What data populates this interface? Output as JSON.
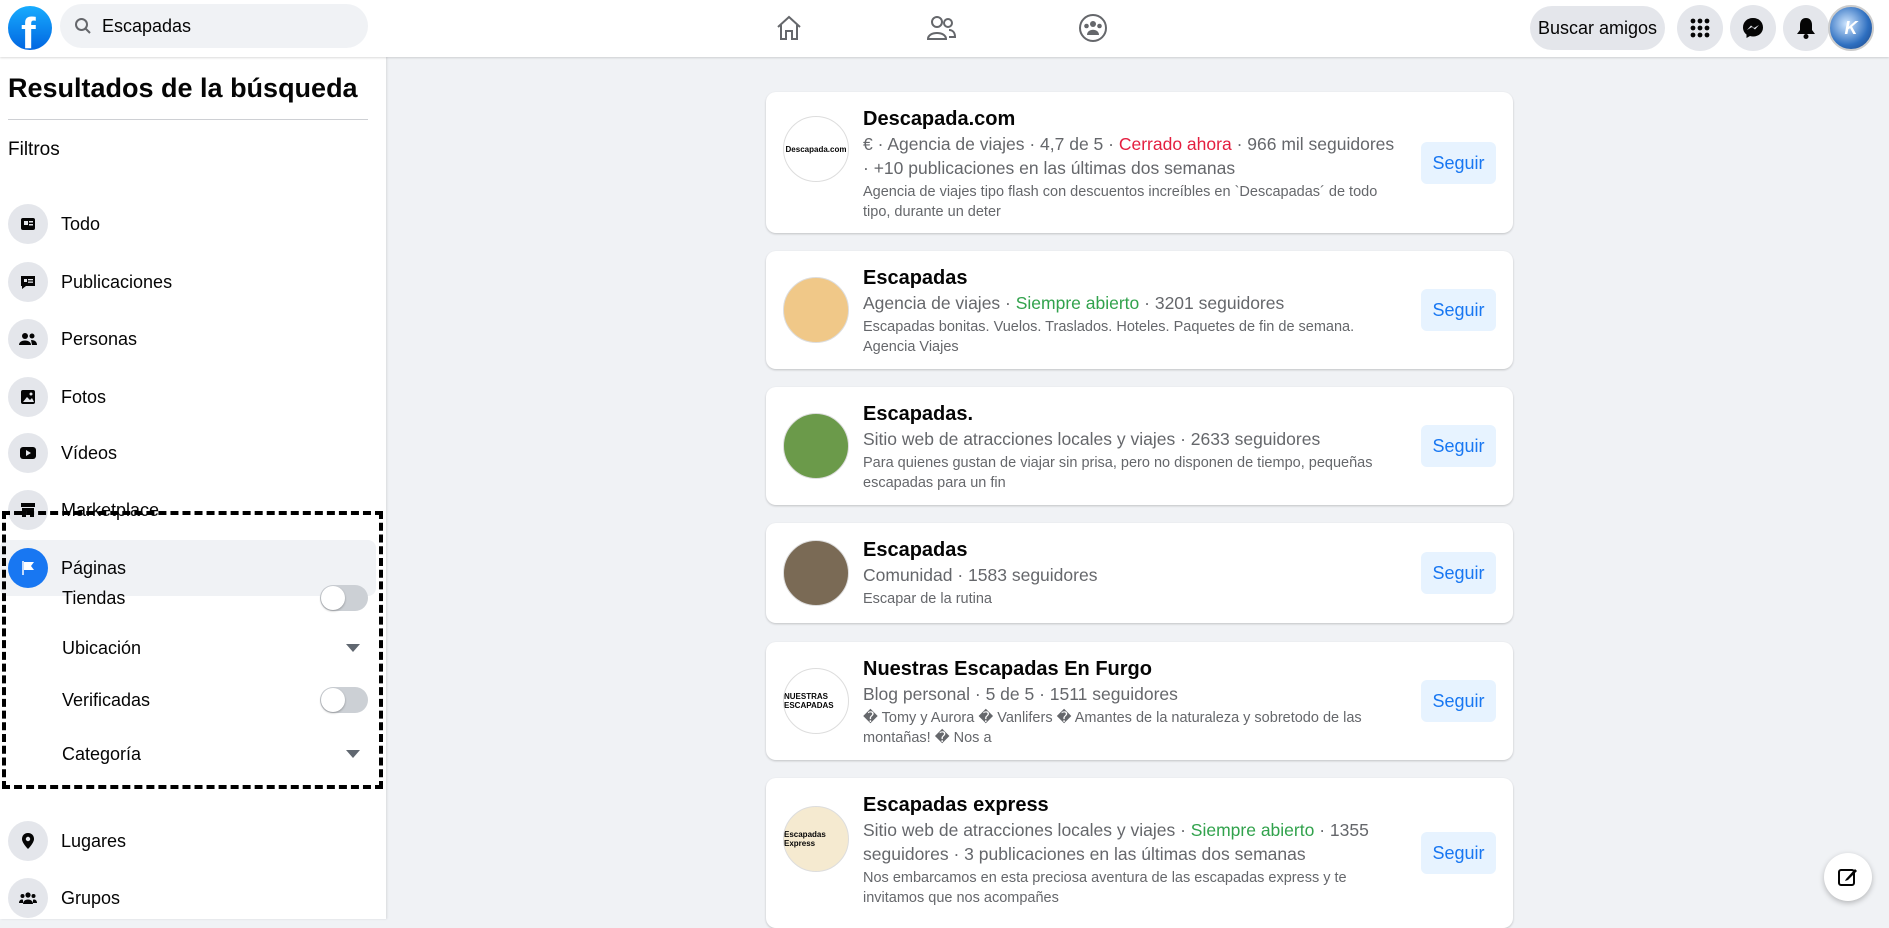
{
  "header": {
    "search_value": "Escapadas",
    "find_friends": "Buscar amigos",
    "avatar_text": "K"
  },
  "sidebar": {
    "title": "Resultados de la búsqueda",
    "filters_label": "Filtros",
    "items": [
      {
        "label": "Todo",
        "icon": "feed-icon"
      },
      {
        "label": "Publicaciones",
        "icon": "posts-icon"
      },
      {
        "label": "Personas",
        "icon": "people-icon"
      },
      {
        "label": "Fotos",
        "icon": "photos-icon"
      },
      {
        "label": "Vídeos",
        "icon": "video-icon"
      },
      {
        "label": "Marketplace",
        "icon": "store-icon"
      },
      {
        "label": "Páginas",
        "icon": "flag-icon",
        "active": true
      },
      {
        "label": "Lugares",
        "icon": "pin-icon"
      },
      {
        "label": "Grupos",
        "icon": "groups-icon"
      }
    ],
    "page_filters": [
      {
        "label": "Tiendas",
        "type": "toggle",
        "on": false
      },
      {
        "label": "Ubicación",
        "type": "dropdown"
      },
      {
        "label": "Verificadas",
        "type": "toggle",
        "on": false
      },
      {
        "label": "Categoría",
        "type": "dropdown"
      }
    ]
  },
  "results": [
    {
      "name": "Descapada.com",
      "meta_a": "€ · Agencia de viajes · 4,7 de 5 · ",
      "status": "Cerrado ahora",
      "status_color": "#e41e3f",
      "meta_b": " · 966 mil seguidores · +10 publicaciones en las últimas dos semanas",
      "desc": "Agencia de viajes tipo flash con descuentos increíbles en `Descapadas´ de todo tipo, durante un deter",
      "avatar_text": "Descapada.com",
      "button": "Seguir"
    },
    {
      "name": "Escapadas",
      "meta_a": "Agencia de viajes · ",
      "status": "Siempre abierto",
      "status_color": "#31a24c",
      "meta_b": " · 3201 seguidores",
      "desc": "Escapadas bonitas. Vuelos. Traslados. Hoteles. Paquetes de fin de semana. Agencia Viajes",
      "avatar_text": "",
      "button": "Seguir"
    },
    {
      "name": "Escapadas.",
      "meta_a": "Sitio web de atracciones locales y viajes · 2633 seguidores",
      "status": "",
      "meta_b": "",
      "desc": "Para quienes gustan de viajar sin prisa, pero no disponen de tiempo, pequeñas escapadas para un fin",
      "avatar_text": "",
      "button": "Seguir"
    },
    {
      "name": "Escapadas",
      "meta_a": "Comunidad · 1583 seguidores",
      "status": "",
      "meta_b": "",
      "desc": "Escapar de la rutina",
      "avatar_text": "",
      "button": "Seguir"
    },
    {
      "name": "Nuestras Escapadas En Furgo",
      "meta_a": "Blog personal · 5 de 5 · 1511 seguidores",
      "status": "",
      "meta_b": "",
      "desc": "� Tomy y Aurora � Vanlifers � Amantes de la naturaleza y sobretodo de las montañas! � Nos a",
      "avatar_text": "NUESTRAS ESCAPADAS",
      "button": "Seguir"
    },
    {
      "name": "Escapadas express",
      "meta_a": "Sitio web de atracciones locales y viajes · ",
      "status": "Siempre abierto",
      "status_color": "#31a24c",
      "meta_b": " · 1355 seguidores · 3 publicaciones en las últimas dos semanas",
      "desc": "Nos embarcamos en esta preciosa aventura de las escapadas express y te invitamos que nos acompañes",
      "avatar_text": "Escapadas Express",
      "button": "Seguir"
    }
  ],
  "colors": {
    "accent": "#1877f2",
    "follow_bg": "#e7f3ff",
    "page_bg": "#f0f2f5"
  }
}
